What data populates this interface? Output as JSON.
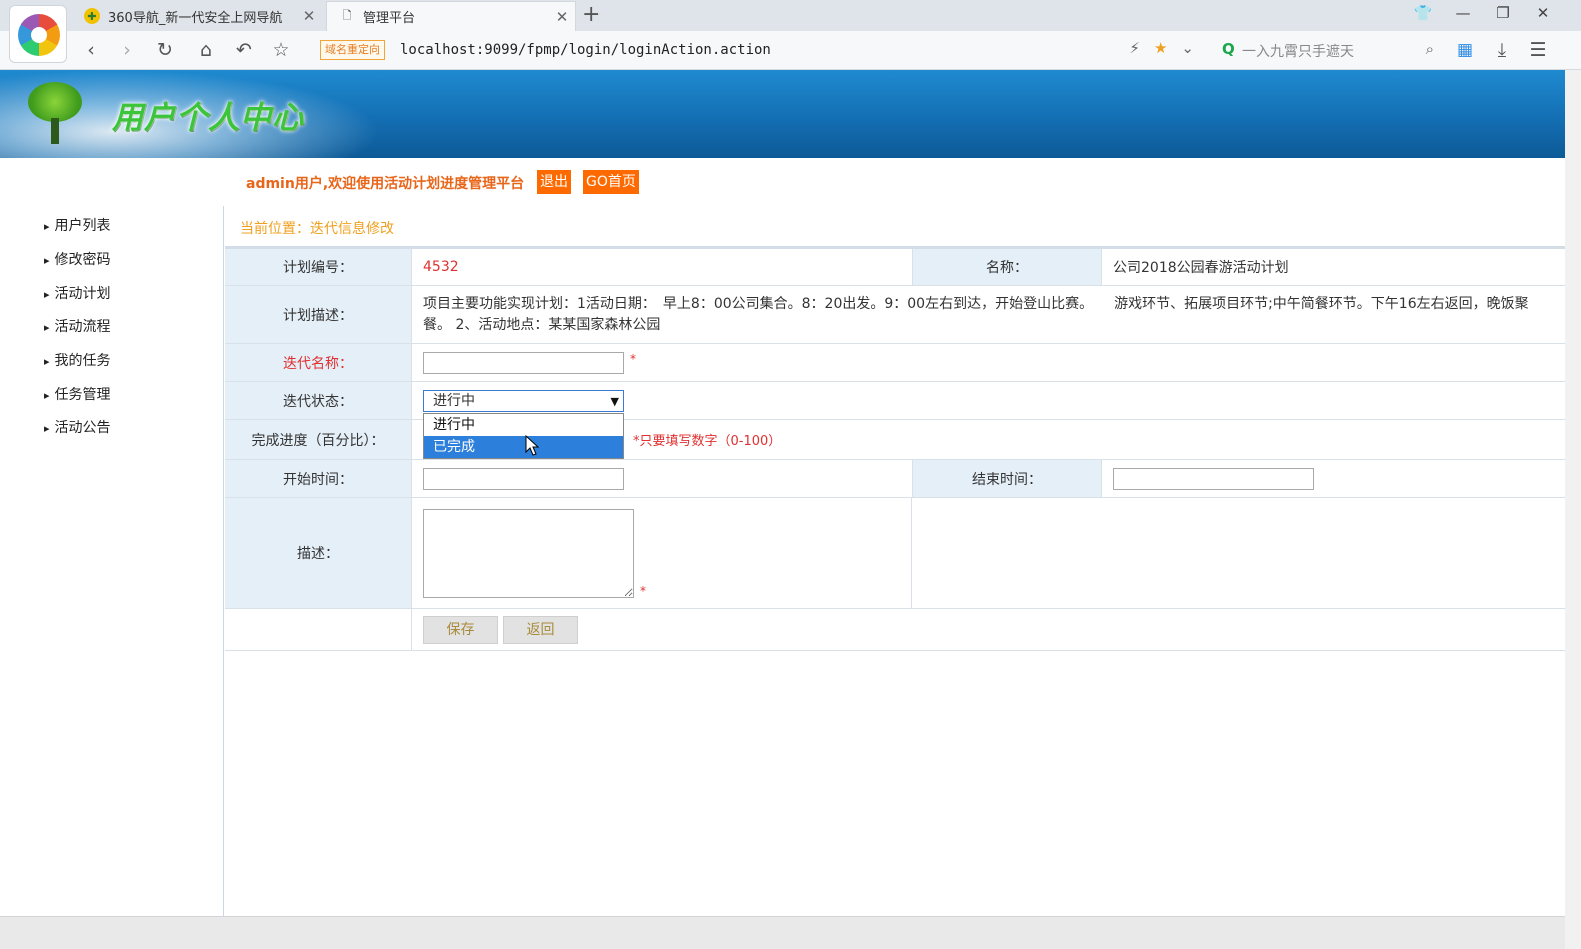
{
  "browser": {
    "tabs": [
      {
        "title": "360导航_新一代安全上网导航",
        "favicon": "360-nav-icon",
        "active": false
      },
      {
        "title": "管理平台",
        "favicon": "page-icon",
        "active": true
      }
    ],
    "new_tab": "+",
    "redirect_badge": "域名重定向",
    "url": "localhost:9099/fpmp/login/loginAction.action",
    "search_placeholder": "一入九霄只手遮天"
  },
  "banner": {
    "title": "用户个人中心"
  },
  "welcome": {
    "text": "admin用户,欢迎使用活动计划进度管理平台",
    "logout_label": "退出",
    "home_label": "GO首页"
  },
  "sidebar": {
    "items": [
      {
        "label": "用户列表"
      },
      {
        "label": "修改密码"
      },
      {
        "label": "活动计划"
      },
      {
        "label": "活动流程"
      },
      {
        "label": "我的任务"
      },
      {
        "label": "任务管理"
      },
      {
        "label": "活动公告"
      }
    ]
  },
  "breadcrumb": "当前位置：迭代信息修改",
  "form": {
    "plan_no_label": "计划编号：",
    "plan_no_value": "4532",
    "name_label": "名称：",
    "name_value": "公司2018公园春游活动计划",
    "plan_desc_label": "计划描述：",
    "plan_desc_value": "项目主要功能实现计划：1活动日期：　早上8：00公司集合。8：20出发。9：00左右到达，开始登山比赛。　　游戏环节、拓展项目环节;中午简餐环节。下午16左右返回，晚饭聚餐。 2、活动地点：某某国家森林公园",
    "iter_name_label": "迭代名称：",
    "iter_name_value": "",
    "iter_status_label": "迭代状态：",
    "iter_status_selected": "进行中",
    "iter_status_options": [
      "进行中",
      "已完成"
    ],
    "iter_status_highlighted": "已完成",
    "progress_label": "完成进度（百分比）：",
    "progress_hint": "*只要填写数字（0-100）",
    "start_label": "开始时间：",
    "start_value": "",
    "end_label": "结束时间：",
    "end_value": "",
    "desc_label": "描述：",
    "desc_value": "",
    "required_mark": "*",
    "save_label": "保存",
    "back_label": "返回"
  }
}
